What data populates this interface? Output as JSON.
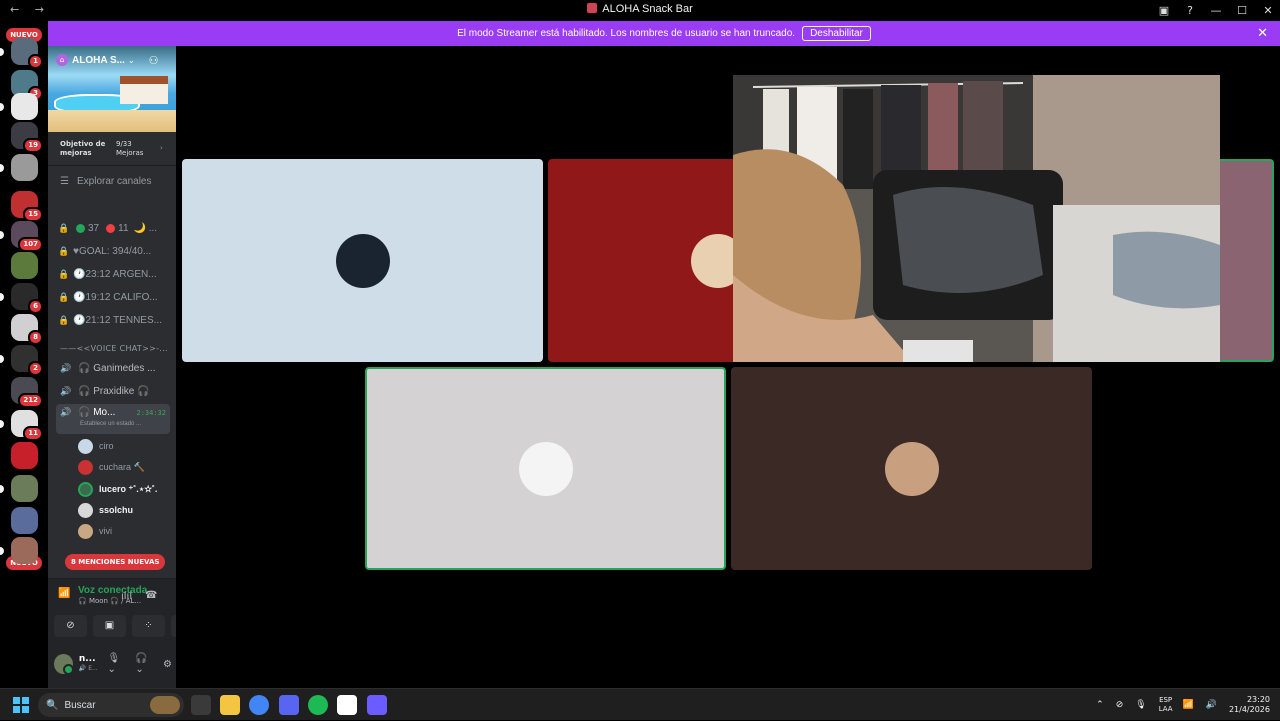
{
  "window": {
    "title": "ALOHA Snack Bar",
    "nav": "← →",
    "controls": [
      "▣",
      "?",
      "—",
      "☐",
      "✕"
    ]
  },
  "banner": {
    "message": "El modo Streamer está habilitado. Los nombres de usuario se han truncado.",
    "button": "Deshabilitar",
    "close": "✕"
  },
  "rail": {
    "new_top": "NUEVO",
    "new_bottom": "NUEVO",
    "servers": [
      {
        "color": "#5a6b7c",
        "count": "1"
      },
      {
        "color": "#4f7a8a",
        "count": "3"
      },
      {
        "color": "#e8e8e8",
        "count": ""
      },
      {
        "color": "#3c3c44",
        "count": "19"
      },
      {
        "color": "#9a9a9a",
        "count": ""
      },
      {
        "color": "#c03030",
        "count": "15"
      },
      {
        "color": "#5a4a5c",
        "count": "107"
      },
      {
        "color": "#5c7a3c",
        "count": ""
      },
      {
        "color": "#2a2a2a",
        "count": "6"
      },
      {
        "color": "#d0d0d0",
        "count": "8"
      },
      {
        "color": "#303030",
        "count": "2"
      },
      {
        "color": "#4a4a52",
        "count": "212"
      },
      {
        "color": "#e0e0e0",
        "count": "11"
      },
      {
        "color": "#c8202a",
        "count": ""
      },
      {
        "color": "#6a7c5a",
        "count": ""
      },
      {
        "color": "#5a6c9c",
        "count": ""
      },
      {
        "color": "#9c6a5a",
        "count": ""
      }
    ]
  },
  "sidebar": {
    "guild_name": "ALOHA S...",
    "boost_label_1": "Objetivo de",
    "boost_label_2": "mejoras",
    "boost_count": "9/33",
    "boost_sub": "Mejoras",
    "boost_arrow": "›",
    "explore": "Explorar canales",
    "channels": [
      {
        "text": "37  11 🌙 ..."
      },
      {
        "text": "♥GOAL: 394/40..."
      },
      {
        "text": "🕐23:12 ARGEN..."
      },
      {
        "text": "🕐19:12 CALIFO..."
      },
      {
        "text": "🕐21:12 TENNES..."
      }
    ],
    "counts": {
      "green": "37",
      "red": "11"
    },
    "category": "——<<VOICE CHAT>>-...",
    "voice_channels": [
      {
        "label": "🎧 Ganimedes ..."
      },
      {
        "label": "🎧 Praxidike 🎧"
      }
    ],
    "active_voice": {
      "label": "🎧 Mo...",
      "timer": "2:34:32",
      "status": "Establece un estado ..."
    },
    "members": [
      {
        "name": "ciro",
        "color": "#c8d8e8"
      },
      {
        "name": "cuchara 🔨",
        "color": "#c83232"
      },
      {
        "name": "lucero ⁺˚.⋆✫˚.",
        "color": "#3c6a4c"
      },
      {
        "name": "ssolchu",
        "color": "#d8d8d8"
      },
      {
        "name": "vivi",
        "color": "#c8a884"
      }
    ],
    "mentions": "8 MENCIONES NUEVAS"
  },
  "voice_panel": {
    "status": "Voz conectada",
    "channel": "🎧 Moon 🎧 / AL...",
    "user_name": "n...",
    "user_sub": "🔊 E..."
  },
  "tiles": [
    {
      "bg": "#cfdde8",
      "avatar": "#1a2430"
    },
    {
      "bg": "#911818",
      "avatar": "#e8d0b0"
    },
    {
      "bg": "#8a6470",
      "avatar": ""
    },
    {
      "bg": "#d4d2d3",
      "avatar": "#f4f4f4"
    },
    {
      "bg": "#3b2925",
      "avatar": "#c8a080"
    }
  ],
  "taskbar": {
    "search": "Buscar",
    "lang": "ESP",
    "lang2": "LAA",
    "time": "23:20",
    "date": "21/4/2026",
    "apps": [
      "#3a3a3a",
      "#f4c542",
      "#4285f4",
      "#5865f2",
      "#1db954",
      "#ffffff",
      "#6a5cff"
    ]
  }
}
